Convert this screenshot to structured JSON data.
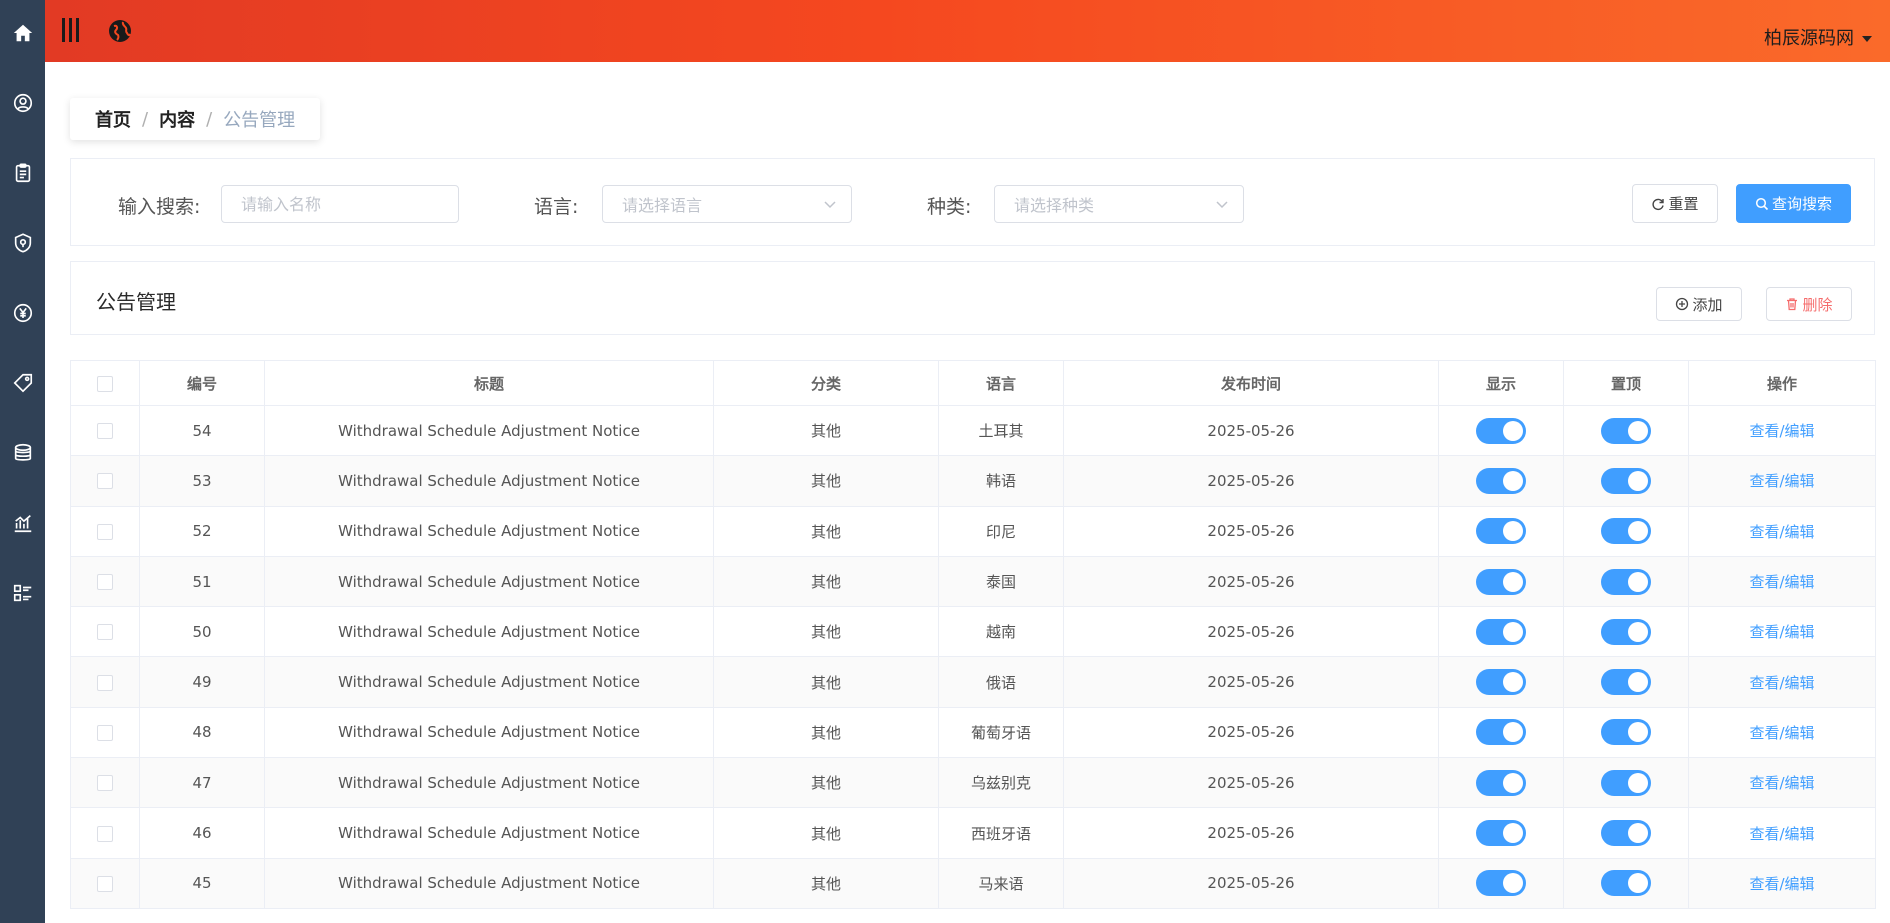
{
  "header": {
    "user_name": "柏辰源码网"
  },
  "breadcrumb": {
    "home": "首页",
    "section": "内容",
    "current": "公告管理",
    "separator": "/"
  },
  "search": {
    "keyword_label": "输入搜索:",
    "keyword_placeholder": "请输入名称",
    "language_label": "语言:",
    "language_placeholder": "请选择语言",
    "category_label": "种类:",
    "category_placeholder": "请选择种类",
    "reset_label": "重置",
    "search_label": "查询搜索"
  },
  "panel": {
    "title": "公告管理",
    "add_label": "添加",
    "delete_label": "删除"
  },
  "table": {
    "columns": [
      "编号",
      "标题",
      "分类",
      "语言",
      "发布时间",
      "显示",
      "置顶",
      "操作"
    ],
    "rows": [
      {
        "id": "54",
        "title": "Withdrawal Schedule Adjustment Notice",
        "category": "其他",
        "language": "土耳其",
        "date": "2025-05-26",
        "show": true,
        "pinned": true,
        "action": "查看/编辑"
      },
      {
        "id": "53",
        "title": "Withdrawal Schedule Adjustment Notice",
        "category": "其他",
        "language": "韩语",
        "date": "2025-05-26",
        "show": true,
        "pinned": true,
        "action": "查看/编辑"
      },
      {
        "id": "52",
        "title": "Withdrawal Schedule Adjustment Notice",
        "category": "其他",
        "language": "印尼",
        "date": "2025-05-26",
        "show": true,
        "pinned": true,
        "action": "查看/编辑"
      },
      {
        "id": "51",
        "title": "Withdrawal Schedule Adjustment Notice",
        "category": "其他",
        "language": "泰国",
        "date": "2025-05-26",
        "show": true,
        "pinned": true,
        "action": "查看/编辑"
      },
      {
        "id": "50",
        "title": "Withdrawal Schedule Adjustment Notice",
        "category": "其他",
        "language": "越南",
        "date": "2025-05-26",
        "show": true,
        "pinned": true,
        "action": "查看/编辑"
      },
      {
        "id": "49",
        "title": "Withdrawal Schedule Adjustment Notice",
        "category": "其他",
        "language": "俄语",
        "date": "2025-05-26",
        "show": true,
        "pinned": true,
        "action": "查看/编辑"
      },
      {
        "id": "48",
        "title": "Withdrawal Schedule Adjustment Notice",
        "category": "其他",
        "language": "葡萄牙语",
        "date": "2025-05-26",
        "show": true,
        "pinned": true,
        "action": "查看/编辑"
      },
      {
        "id": "47",
        "title": "Withdrawal Schedule Adjustment Notice",
        "category": "其他",
        "language": "乌兹别克",
        "date": "2025-05-26",
        "show": true,
        "pinned": true,
        "action": "查看/编辑"
      },
      {
        "id": "46",
        "title": "Withdrawal Schedule Adjustment Notice",
        "category": "其他",
        "language": "西班牙语",
        "date": "2025-05-26",
        "show": true,
        "pinned": true,
        "action": "查看/编辑"
      },
      {
        "id": "45",
        "title": "Withdrawal Schedule Adjustment Notice",
        "category": "其他",
        "language": "马来语",
        "date": "2025-05-26",
        "show": true,
        "pinned": true,
        "action": "查看/编辑"
      }
    ]
  },
  "sidebar": {
    "icons": [
      "home-icon",
      "user-circle-icon",
      "clipboard-icon",
      "shield-icon",
      "yuan-icon",
      "tag-icon",
      "coins-icon",
      "chart-icon",
      "list-icon"
    ]
  },
  "colors": {
    "accent": "#409eff",
    "header_start": "#e23a24",
    "header_end": "#fa6a2a",
    "sidebar": "#304156",
    "danger": "#f56c6c"
  }
}
